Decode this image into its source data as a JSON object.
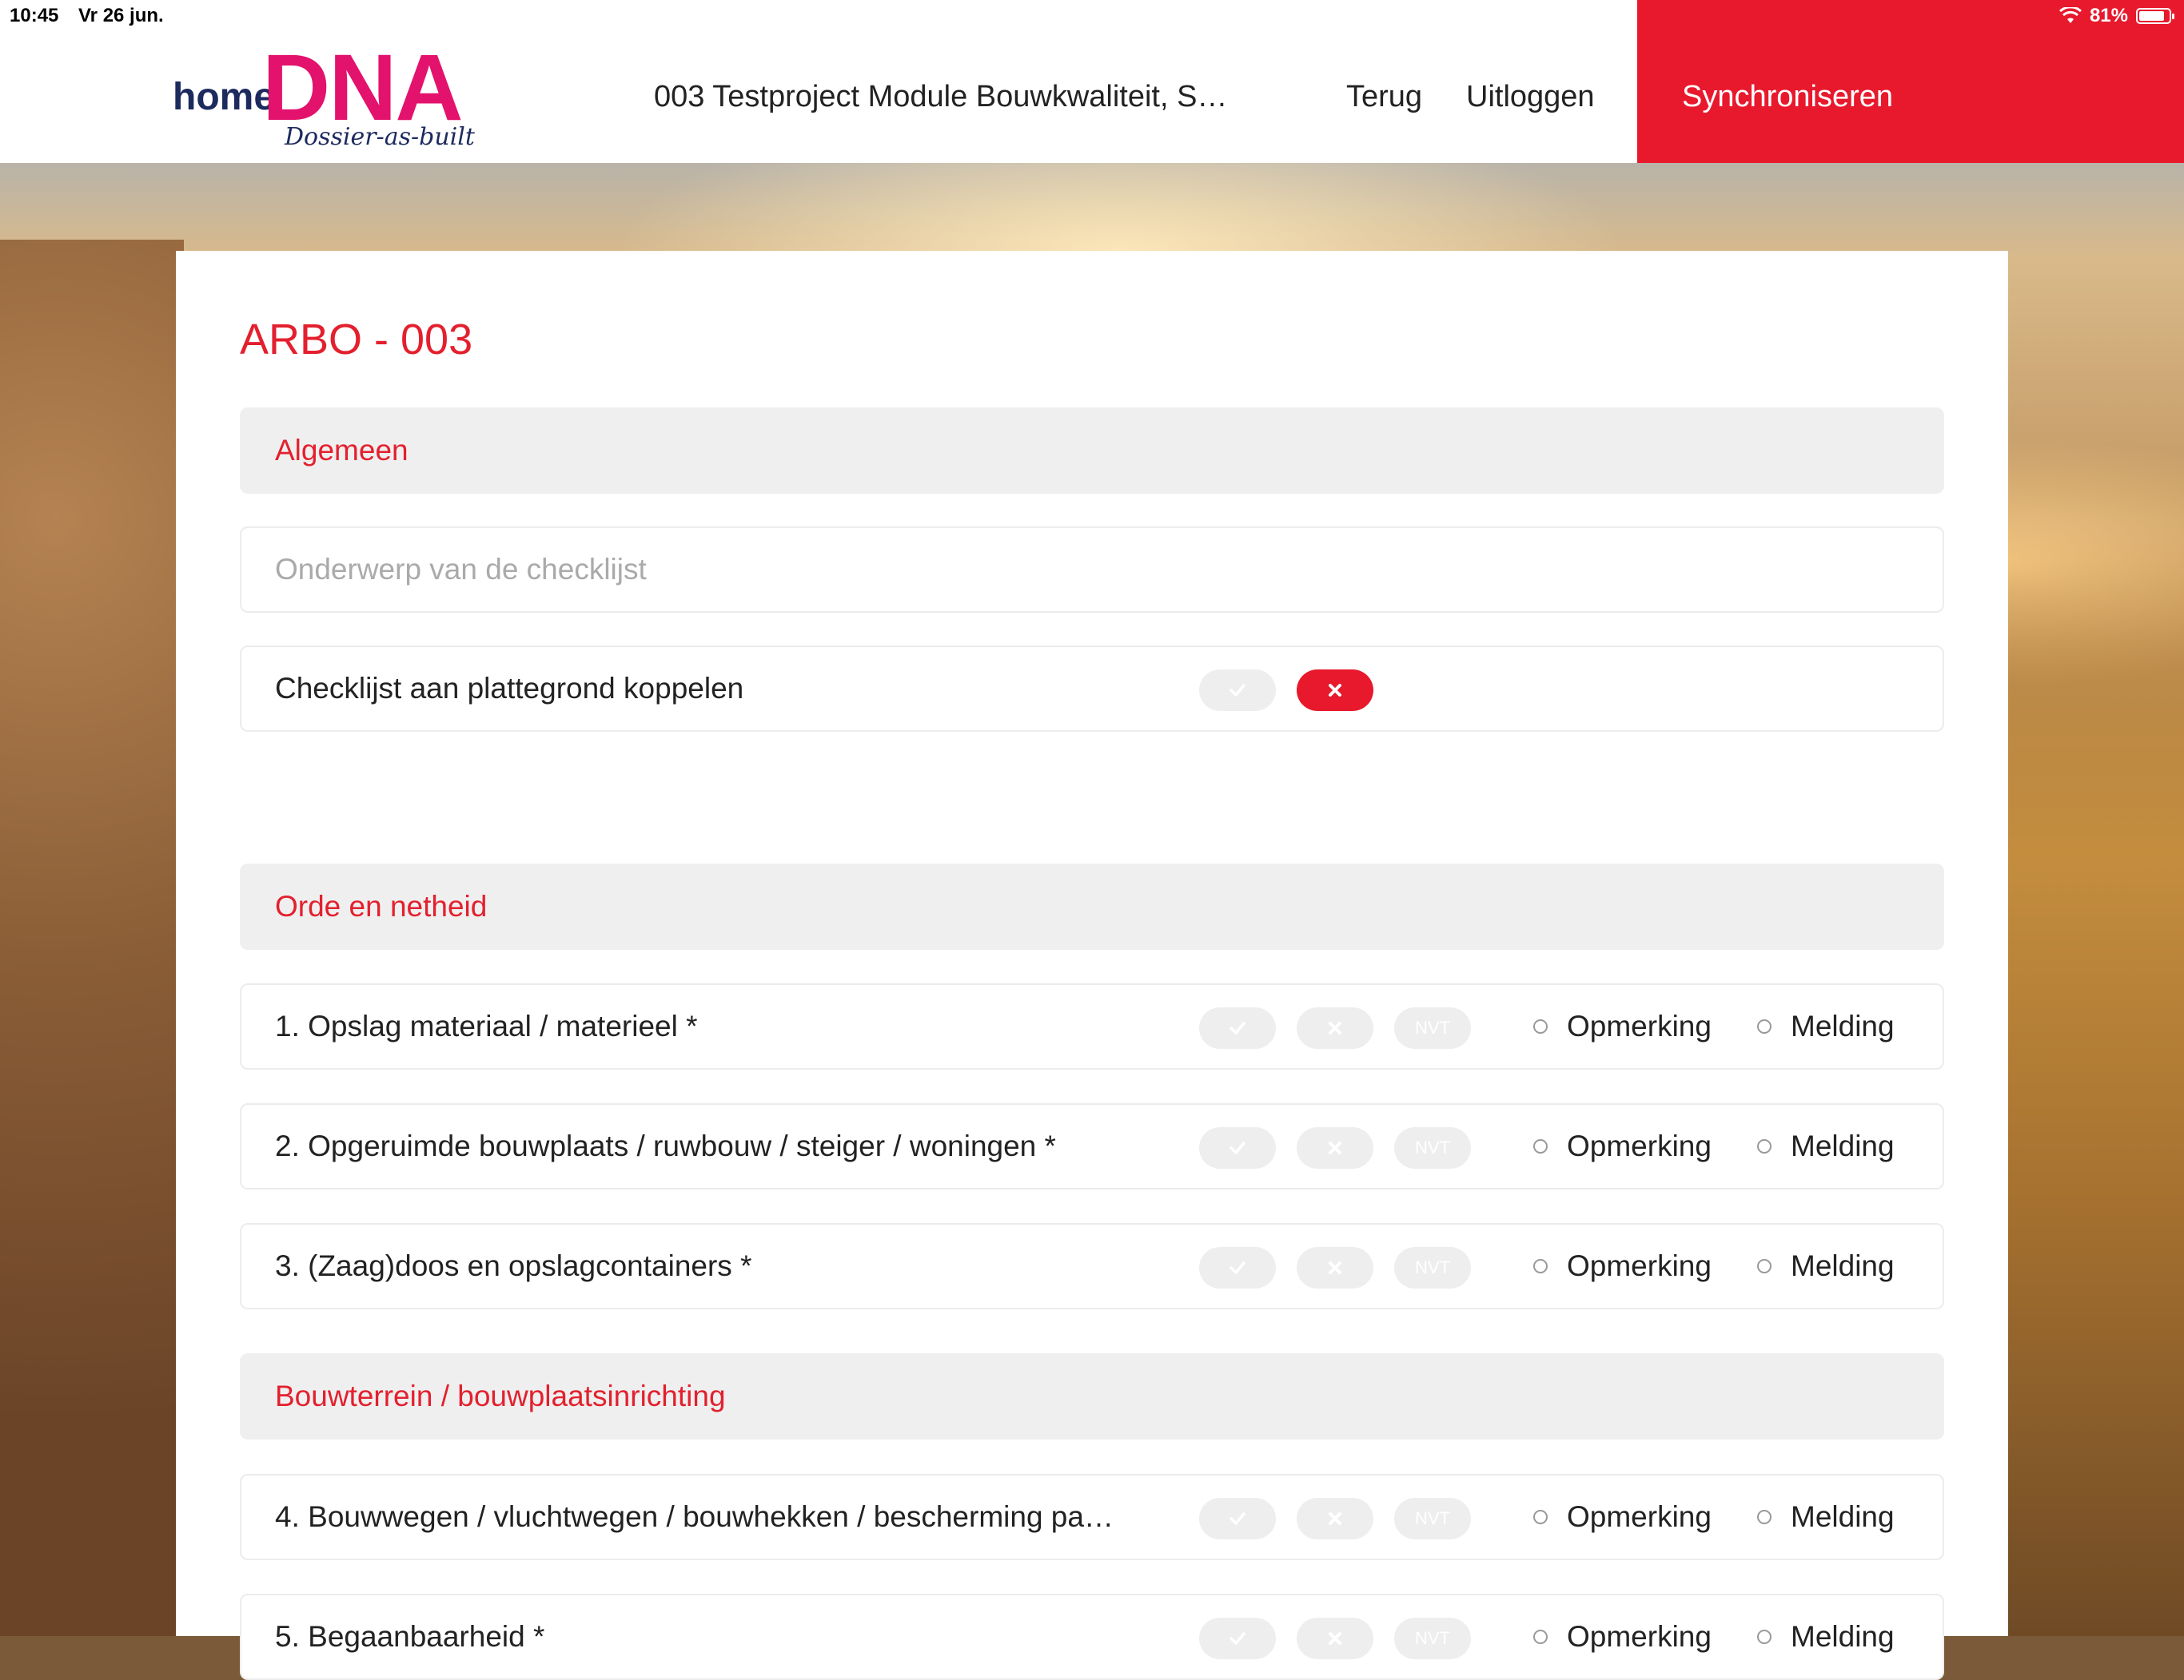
{
  "status_bar": {
    "time": "10:45",
    "date": "Vr 26 jun.",
    "battery": "81%"
  },
  "header": {
    "logo_home": "home",
    "logo_dna": "DNA",
    "logo_tagline": "Dossier-as-built",
    "project_title": "003 Testproject Module Bouwkwaliteit, S…",
    "back_label": "Terug",
    "logout_label": "Uitloggen",
    "sync_label": "Synchroniseren"
  },
  "page": {
    "title": "ARBO - 003",
    "sections": [
      {
        "title": "Algemeen"
      },
      {
        "title": "Orde en netheid"
      },
      {
        "title": "Bouwterrein / bouwplaatsinrichting"
      }
    ],
    "subject_placeholder": "Onderwerp van de checklijst",
    "link_plan_label": "Checklijst aan plattegrond koppelen",
    "items": [
      {
        "label": "1. Opslag materiaal / materieel *"
      },
      {
        "label": "2. Opgeruimde bouwplaats / ruwbouw / steiger / woningen *"
      },
      {
        "label": "3. (Zaag)doos en opslagcontainers *"
      },
      {
        "label": "4. Bouwwegen / vluchtwegen / bouwhekken / bescherming pa…"
      },
      {
        "label": "5. Begaanbaarheid *"
      }
    ],
    "nvt_label": "NVT",
    "remark_label": "Opmerking",
    "report_label": "Melding"
  },
  "colors": {
    "accent": "#e8192c",
    "logo_blue": "#1c2a5e",
    "logo_pink": "#e3126c"
  }
}
